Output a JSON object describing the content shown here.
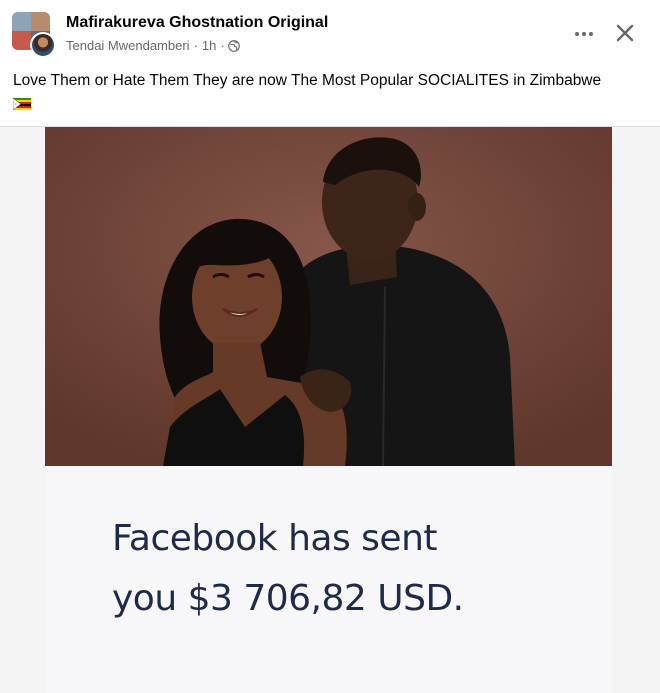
{
  "post": {
    "group_name": "Mafirakureva Ghostnation Original",
    "author": "Tendai Mwendamberi",
    "separator": "·",
    "time": "1h",
    "separator2": "·",
    "text": "Love Them or Hate Them They are now The Most Popular SOCIALITES in Zimbabwe",
    "flag_icon": "zimbabwe-flag-emoji"
  },
  "actions": {
    "more_icon": "more-options-icon",
    "close_icon": "close-icon"
  },
  "image_caption": {
    "line1": "Facebook has sent",
    "line2": "you $3 706,82 USD."
  },
  "colors": {
    "photo_background": "#6b4033",
    "promo_text": "#1f2a4a",
    "meta_gray": "#65676b"
  }
}
